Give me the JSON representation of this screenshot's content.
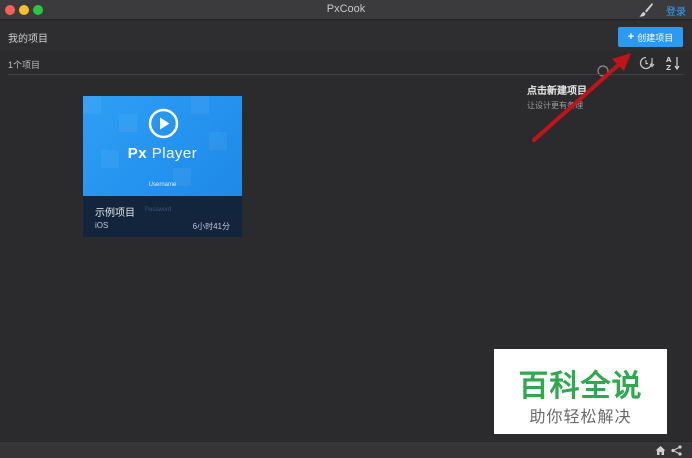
{
  "window": {
    "title": "PxCook",
    "login_label": "登录"
  },
  "header": {
    "title": "我的项目",
    "create_button_label": "创建项目",
    "create_button_icon": "plus-icon"
  },
  "toolbar": {
    "count": "1个项目"
  },
  "tooltip": {
    "title": "点击新建项目",
    "description": "让设计更有条理"
  },
  "project": {
    "thumbnail_title_prefix": "Px",
    "thumbnail_title_rest": " Player",
    "thumbnail_username": "Username",
    "thumbnail_password": "Password",
    "name": "示例项目",
    "platform": "iOS",
    "time": "6小时41分"
  },
  "watermark": {
    "main": "百科全说",
    "sub": "助你轻松解决"
  },
  "colors": {
    "accent": "#2b9af3",
    "background": "#2b2b2d",
    "card_info_bg": "#12253d",
    "arrow": "#c0141a",
    "watermark_green": "#2fa84f"
  },
  "icons": [
    "brush-icon",
    "search-icon",
    "sort-time-icon",
    "sort-az-icon",
    "play-icon",
    "home-icon",
    "share-icon"
  ]
}
